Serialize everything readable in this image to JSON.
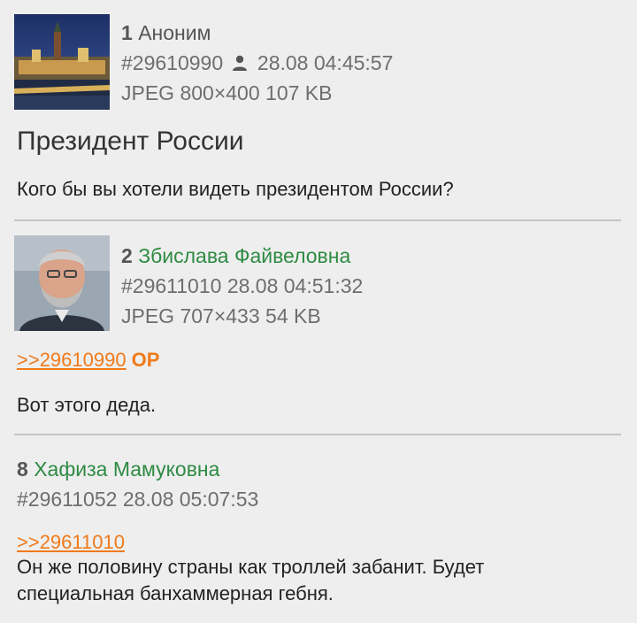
{
  "posts": [
    {
      "number": "1",
      "author": "Аноним",
      "id": "#29610990",
      "date": "28.08 04:45:57",
      "file": "JPEG 800×400 107 KB",
      "subject": "Президент России",
      "text": "Кого бы вы хотели видеть президентом России?"
    },
    {
      "number": "2",
      "author": "Збислава Файвеловна",
      "id": "#29611010",
      "date": "28.08 04:51:32",
      "file": "JPEG 707×433 54 KB",
      "reply": ">>29610990",
      "op_tag": "OP",
      "text": "Вот этого деда."
    },
    {
      "number": "8",
      "author": "Хафиза Мамуковна",
      "id": "#29611052",
      "date": "28.08 05:07:53",
      "reply": ">>29611010",
      "text_lines": [
        "Он же половину страны как троллей забанит. Будет",
        "специальная банхаммерная гебня."
      ]
    }
  ],
  "colors": {
    "background": "#eeeeee",
    "link": "#f07a1a",
    "author_name": "#2e8b43",
    "meta": "#6e6e6e"
  },
  "icons": {
    "post1_user": "user-icon"
  }
}
